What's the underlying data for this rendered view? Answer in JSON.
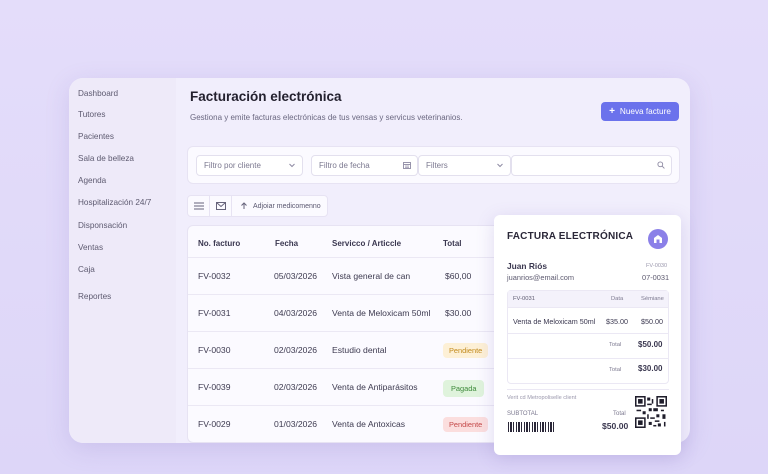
{
  "sidebar": {
    "items": [
      {
        "label": "Dashboard"
      },
      {
        "label": "Tutores"
      },
      {
        "label": "Pacientes"
      },
      {
        "label": "Sala de belleza"
      },
      {
        "label": "Agenda"
      },
      {
        "label": "Hospitalización 24/7"
      },
      {
        "label": "Disponsación"
      },
      {
        "label": "Ventas"
      },
      {
        "label": "Caja"
      },
      {
        "label": "Reportes"
      }
    ]
  },
  "header": {
    "title": "Facturación electrónica",
    "subtitle": "Gestiona y emite facturas electrónicas de tus vensas y servicus veterinanios.",
    "new_button": "Nueva facture"
  },
  "filters": {
    "client": "Filtro por cliente",
    "date": "Filtro de fecha",
    "status": "Filters",
    "search_placeholder": ""
  },
  "toolbar": {
    "add_label": "Adjoiar medicomenno"
  },
  "table": {
    "columns": [
      "No. facturo",
      "Fecha",
      "Servicco / Articcle",
      "Total"
    ],
    "rows": [
      {
        "no": "FV-0032",
        "date": "05/03/2026",
        "service": "Vista general de can",
        "total": "$60,00",
        "status": ""
      },
      {
        "no": "FV-0031",
        "date": "04/03/2026",
        "service": "Venta de Meloxicam 50ml",
        "total": "$30.00",
        "status": ""
      },
      {
        "no": "FV-0030",
        "date": "02/03/2026",
        "service": "Estudio dental",
        "total": "",
        "status": "Pendiente"
      },
      {
        "no": "FV-0039",
        "date": "02/03/2026",
        "service": "Venta de Antiparásitos",
        "total": "",
        "status": "Pagada"
      },
      {
        "no": "FV-0029",
        "date": "01/03/2026",
        "service": "Venta de Antoxicas",
        "total": "",
        "status": "Pendiente"
      }
    ]
  },
  "invoice": {
    "title": "FACTURA ELECTRÓNICA",
    "client_name": "Juan Riós",
    "client_email": "juanrios@email.com",
    "ref_label": "FV-0030",
    "ref_number": "07-0031",
    "items_header": {
      "col1": "FV-0031",
      "col2": "Data",
      "col3": "Sémiane"
    },
    "item": {
      "desc": "Venta de Meloxicam 50ml",
      "price": "$35.00",
      "amount": "$50.00"
    },
    "total_rows": [
      {
        "label": "Total",
        "value": "$50.00"
      },
      {
        "label": "Total",
        "value": "$30.00"
      }
    ],
    "verify_text": "Verit cd Metropoliselle client",
    "subtotal_label": "SUBTOTAL",
    "total_label": "Total",
    "total_value": "$50.00"
  },
  "colors": {
    "accent": "#6b72ec",
    "pending_bg": "#fdf0d6",
    "pending_fg": "#c28a1c",
    "paid_bg": "#dff3dc",
    "paid_fg": "#3d8a3a",
    "overdue_bg": "#fbdede",
    "overdue_fg": "#c44848"
  }
}
